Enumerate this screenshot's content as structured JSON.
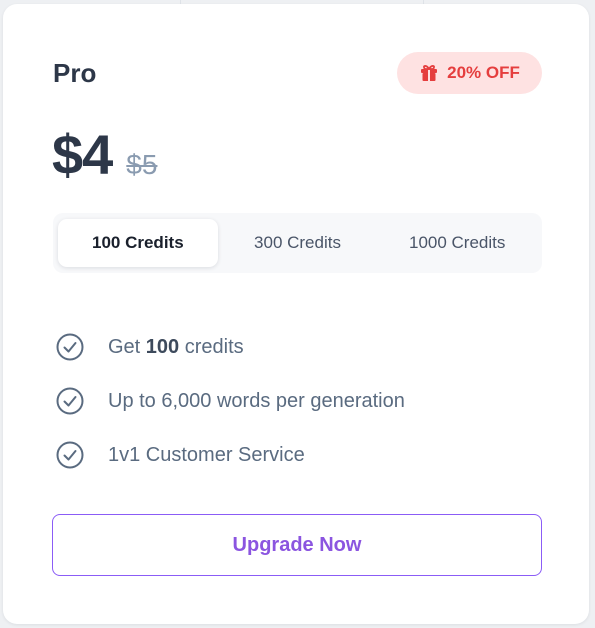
{
  "plan": {
    "name": "Pro",
    "badge": {
      "label": "20% OFF",
      "icon": "gift-icon",
      "color": "#e53e3e",
      "background": "#fee2e2"
    },
    "price": {
      "current": "$4",
      "original": "$5"
    }
  },
  "credit_tabs": [
    {
      "label": "100 Credits",
      "selected": true
    },
    {
      "label": "300 Credits",
      "selected": false
    },
    {
      "label": "1000 Credits",
      "selected": false
    }
  ],
  "features": [
    {
      "prefix": "Get ",
      "bold": "100",
      "suffix": " credits",
      "icon": "check-circle-icon"
    },
    {
      "prefix": "Up to 6,000 words per generation",
      "bold": "",
      "suffix": "",
      "icon": "check-circle-icon"
    },
    {
      "prefix": "1v1 Customer Service",
      "bold": "",
      "suffix": "",
      "icon": "check-circle-icon"
    }
  ],
  "cta": {
    "label": "Upgrade Now",
    "color": "#8b5cf6"
  }
}
